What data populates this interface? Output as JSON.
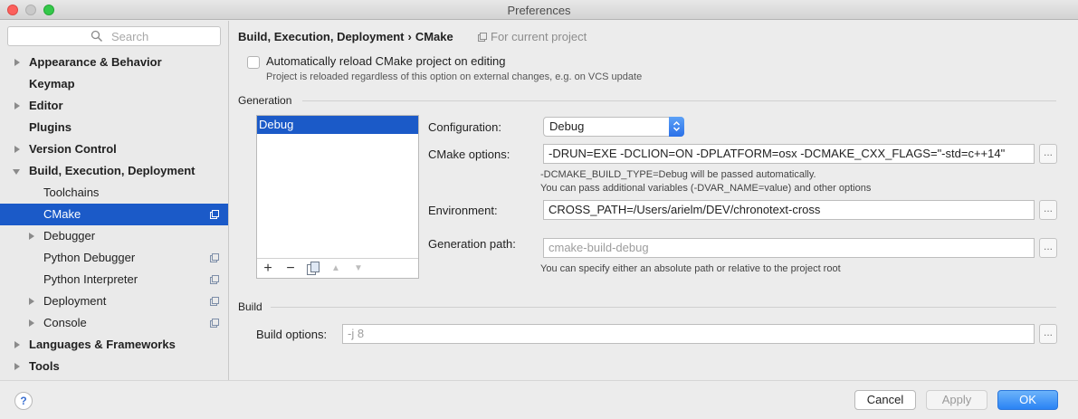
{
  "window": {
    "title": "Preferences"
  },
  "sidebar": {
    "search_placeholder": "Search",
    "items": [
      {
        "label": "Appearance & Behavior",
        "bold": true,
        "arrow": "right"
      },
      {
        "label": "Keymap",
        "bold": true,
        "arrow": "none"
      },
      {
        "label": "Editor",
        "bold": true,
        "arrow": "right"
      },
      {
        "label": "Plugins",
        "bold": true,
        "arrow": "none"
      },
      {
        "label": "Version Control",
        "bold": true,
        "arrow": "right"
      },
      {
        "label": "Build, Execution, Deployment",
        "bold": true,
        "arrow": "down"
      },
      {
        "label": "Toolchains",
        "bold": false,
        "arrow": "none"
      },
      {
        "label": "CMake",
        "bold": false,
        "arrow": "none",
        "selected": true,
        "project_icon": true
      },
      {
        "label": "Debugger",
        "bold": false,
        "arrow": "right"
      },
      {
        "label": "Python Debugger",
        "bold": false,
        "arrow": "none",
        "project_icon": true
      },
      {
        "label": "Python Interpreter",
        "bold": false,
        "arrow": "none",
        "project_icon": true
      },
      {
        "label": "Deployment",
        "bold": false,
        "arrow": "right",
        "project_icon": true
      },
      {
        "label": "Console",
        "bold": false,
        "arrow": "right",
        "project_icon": true
      },
      {
        "label": "Languages & Frameworks",
        "bold": true,
        "arrow": "right"
      },
      {
        "label": "Tools",
        "bold": true,
        "arrow": "right"
      }
    ]
  },
  "breadcrumb": {
    "parent": "Build, Execution, Deployment",
    "separator": "›",
    "current": "CMake",
    "note": "For current project"
  },
  "auto_reload": {
    "label": "Automatically reload CMake project on editing",
    "checked": false,
    "help": "Project is reloaded regardless of this option on external changes, e.g. on VCS update"
  },
  "generation": {
    "section_label": "Generation",
    "profiles": [
      "Debug"
    ],
    "selected_profile": "Debug",
    "toolbar": {
      "add": "+",
      "remove": "−",
      "up": "▲",
      "down": "▼"
    },
    "configuration_label": "Configuration:",
    "configuration_value": "Debug",
    "cmake_options_label": "CMake options:",
    "cmake_options_value": "-DRUN=EXE -DCLION=ON -DPLATFORM=osx -DCMAKE_CXX_FLAGS=\"-std=c++14\"",
    "cmake_help_1": "-DCMAKE_BUILD_TYPE=Debug will be passed automatically.",
    "cmake_help_2": "You can pass additional variables (-DVAR_NAME=value) and other options",
    "environment_label": "Environment:",
    "environment_value": "CROSS_PATH=/Users/arielm/DEV/chronotext-cross",
    "generation_path_label": "Generation path:",
    "generation_path_placeholder": "cmake-build-debug",
    "generation_path_help": "You can specify either an absolute path or relative to the project root",
    "browse": "..."
  },
  "build": {
    "section_label": "Build",
    "options_label": "Build options:",
    "options_placeholder": "-j 8",
    "browse": "..."
  },
  "footer": {
    "help": "?",
    "cancel": "Cancel",
    "apply": "Apply",
    "ok": "OK"
  },
  "colors": {
    "selection": "#1b5ac8",
    "accent": "#2a83f4"
  }
}
